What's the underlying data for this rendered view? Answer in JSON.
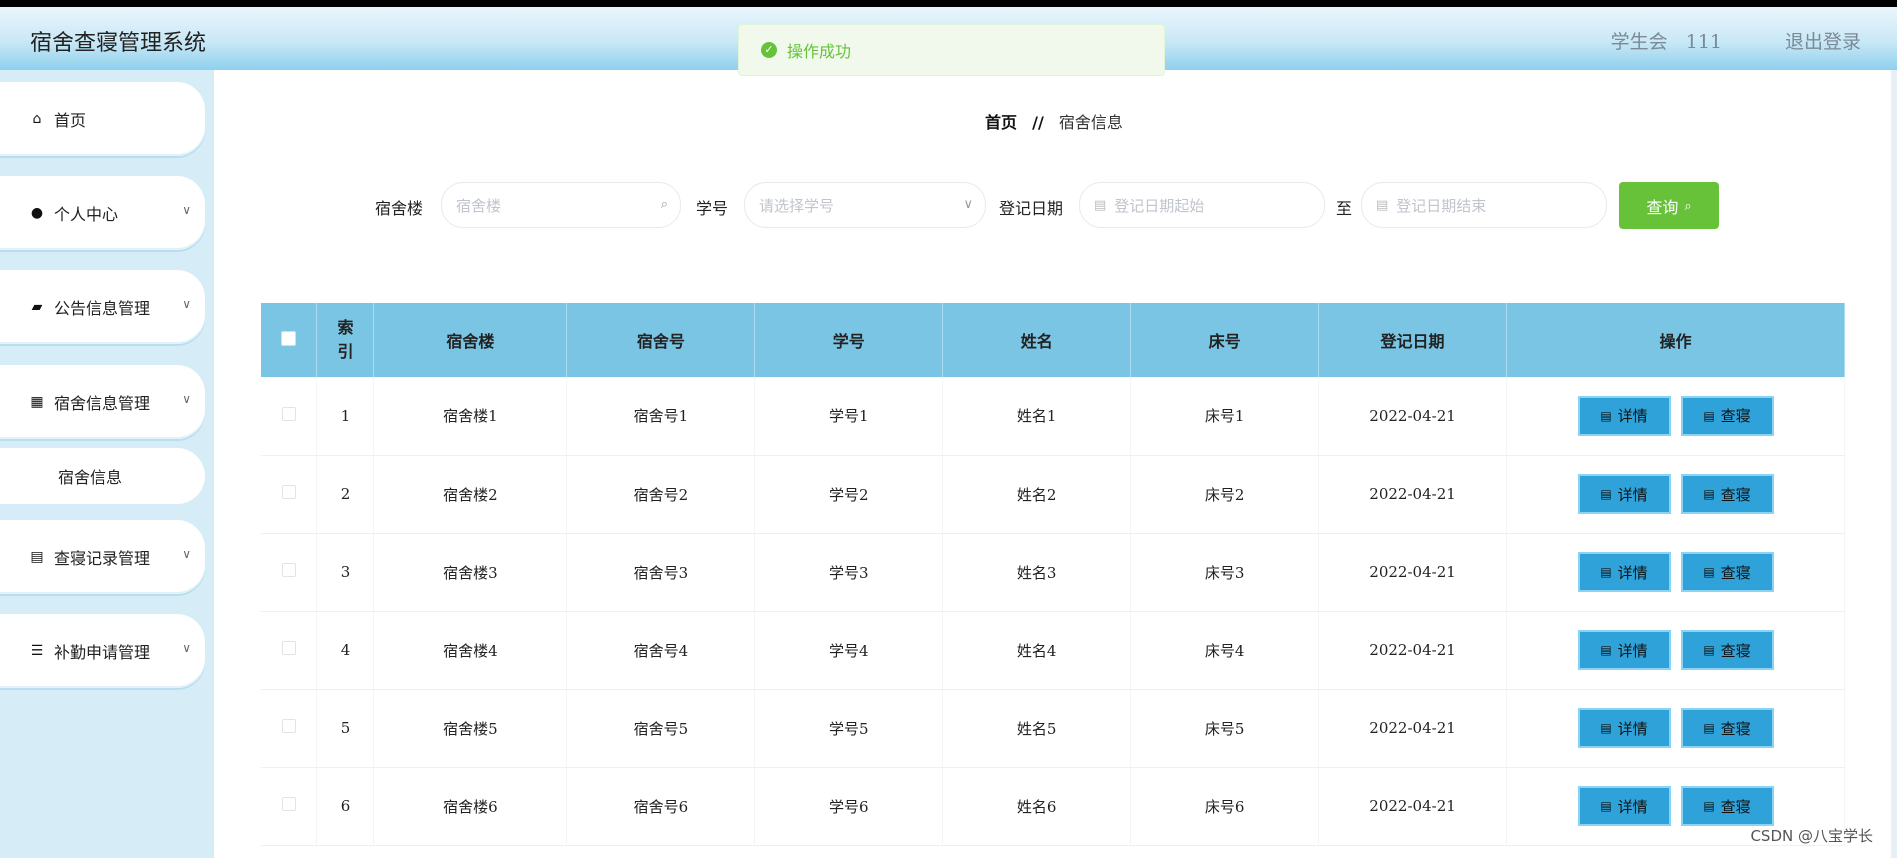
{
  "header": {
    "app_title": "宿舍查寝管理系统",
    "user_role": "学生会",
    "user_name": "111",
    "logout": "退出登录"
  },
  "toast": {
    "text": "操作成功"
  },
  "sidebar": {
    "items": [
      {
        "label": "首页"
      },
      {
        "label": "个人中心"
      },
      {
        "label": "公告信息管理"
      },
      {
        "label": "宿舍信息管理"
      },
      {
        "label": "宿舍信息"
      },
      {
        "label": "查寝记录管理"
      },
      {
        "label": "补勤申请管理"
      }
    ]
  },
  "breadcrumb": {
    "home": "首页",
    "separator": "//",
    "current": "宿舍信息"
  },
  "search": {
    "building_label": "宿舍楼",
    "building_placeholder": "宿舍楼",
    "student_label": "学号",
    "student_placeholder": "请选择学号",
    "date_label": "登记日期",
    "date_start_placeholder": "登记日期起始",
    "date_to": "至",
    "date_end_placeholder": "登记日期结束",
    "query_label": "查询"
  },
  "table": {
    "headers": [
      "索引",
      "宿舍楼",
      "宿舍号",
      "学号",
      "姓名",
      "床号",
      "登记日期",
      "操作"
    ],
    "detail_label": "详情",
    "check_label": "查寝",
    "rows": [
      {
        "index": "1",
        "building": "宿舍楼1",
        "room": "宿舍号1",
        "student_no": "学号1",
        "name": "姓名1",
        "bed": "床号1",
        "date": "2022-04-21"
      },
      {
        "index": "2",
        "building": "宿舍楼2",
        "room": "宿舍号2",
        "student_no": "学号2",
        "name": "姓名2",
        "bed": "床号2",
        "date": "2022-04-21"
      },
      {
        "index": "3",
        "building": "宿舍楼3",
        "room": "宿舍号3",
        "student_no": "学号3",
        "name": "姓名3",
        "bed": "床号3",
        "date": "2022-04-21"
      },
      {
        "index": "4",
        "building": "宿舍楼4",
        "room": "宿舍号4",
        "student_no": "学号4",
        "name": "姓名4",
        "bed": "床号4",
        "date": "2022-04-21"
      },
      {
        "index": "5",
        "building": "宿舍楼5",
        "room": "宿舍号5",
        "student_no": "学号5",
        "name": "姓名5",
        "bed": "床号5",
        "date": "2022-04-21"
      },
      {
        "index": "6",
        "building": "宿舍楼6",
        "room": "宿舍号6",
        "student_no": "学号6",
        "name": "姓名6",
        "bed": "床号6",
        "date": "2022-04-21"
      }
    ]
  },
  "watermark": "CSDN @八宝学长",
  "colors": {
    "accent": "#7bc5e4",
    "success": "#67c23a",
    "op_button": "#2fa3d9"
  }
}
